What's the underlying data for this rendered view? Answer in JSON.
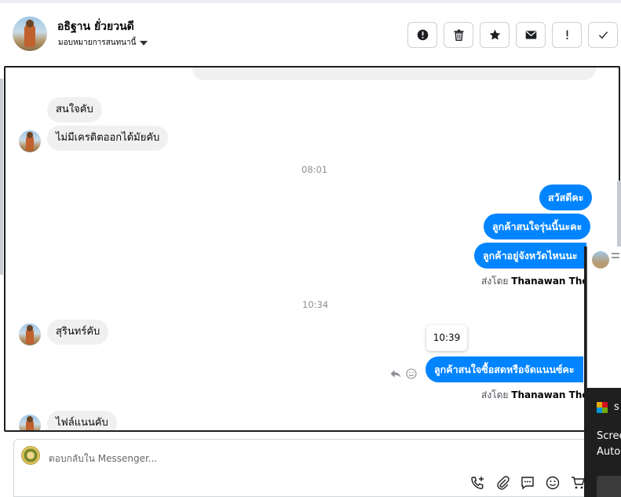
{
  "header": {
    "contact_name": "อธิฐาน ยั่วยวนดี",
    "assign_label": "มอบหมายการสนทนานี้",
    "buttons": [
      {
        "name": "spam-button",
        "icon": "alert-circle-icon"
      },
      {
        "name": "delete-button",
        "icon": "trash-icon"
      },
      {
        "name": "star-button",
        "icon": "star-icon"
      },
      {
        "name": "mark-unread-button",
        "icon": "envelope-icon"
      },
      {
        "name": "follow-up-button",
        "icon": "exclamation-icon"
      },
      {
        "name": "mark-done-button",
        "icon": "checkmark-icon"
      }
    ]
  },
  "conversation": {
    "incoming_1": "สนใจคับ",
    "incoming_2": "ไม่มีเครดิตออกได้มัยคับ",
    "time_1": "08:01",
    "outgoing_1": "สวัสดีคะ",
    "outgoing_2": "ลูกค้าสนใจรุ่นนี้นะคะ",
    "outgoing_3": "ลูกค้าอยู่จังหวัดไหนนะ",
    "sent_by_prefix": "ส่งโดย",
    "sent_by_name": "Thanawan Thon",
    "time_2": "10:34",
    "incoming_3": "สุรินทร์คับ",
    "tooltip_time": "10:39",
    "outgoing_4": "ลูกค้าสนใจซื้อสดหรือจัดแนนซ์คะ",
    "incoming_4": "ไฟล์แนนคับ"
  },
  "reply": {
    "placeholder": "ตอบกลับใน Messenger..."
  },
  "overlay": {
    "letter": "s",
    "line1": "Scree",
    "line2": "Auto"
  },
  "colors": {
    "outgoing_bubble": "#0084ff",
    "incoming_bubble": "#f0f0f0"
  }
}
